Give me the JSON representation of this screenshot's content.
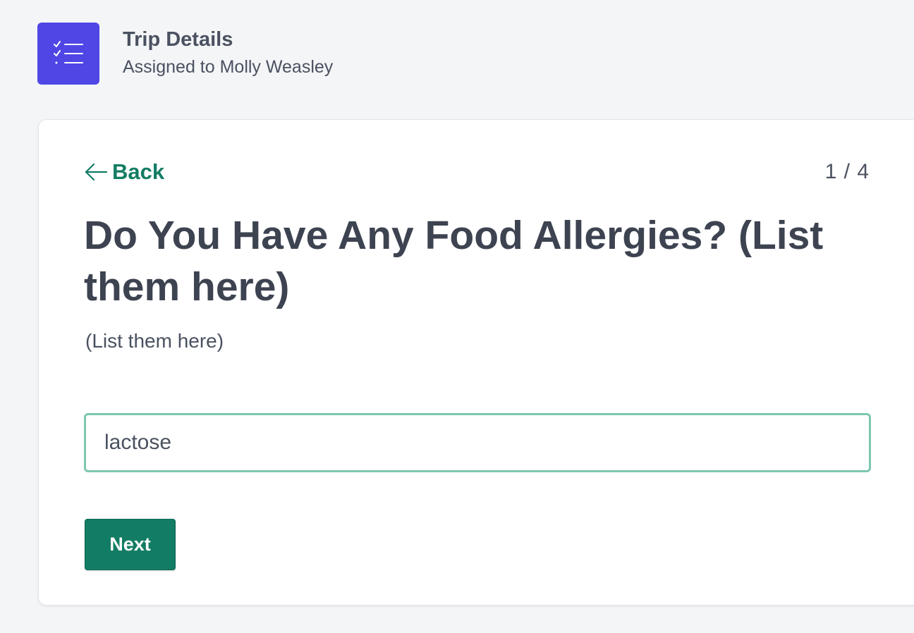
{
  "header": {
    "icon": "checklist-icon",
    "title": "Trip Details",
    "subtitle": "Assigned to Molly Weasley"
  },
  "card": {
    "back_label": "Back",
    "step_counter": "1 / 4",
    "question": "Do You Have Any Food Allergies? (List them here)",
    "description": "(List them here)",
    "answer_value": "lactose",
    "next_label": "Next"
  },
  "colors": {
    "brand": "#4f46e5",
    "accent": "#137c64",
    "input_border": "#7dc7b1",
    "background": "#f4f5f7"
  }
}
